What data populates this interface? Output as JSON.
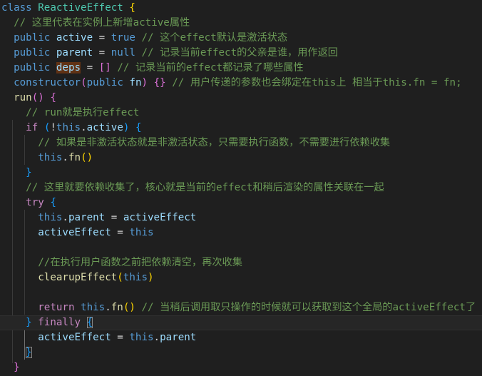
{
  "editor": {
    "language": "typescript",
    "highlighted_word": "deps",
    "lines": [
      {
        "tokens": [
          [
            "kw",
            "class"
          ],
          [
            "punc",
            " "
          ],
          [
            "cls",
            "ReactiveEffect"
          ],
          [
            "punc",
            " "
          ],
          [
            "b1",
            "{"
          ]
        ]
      },
      {
        "tokens": [
          [
            "punc",
            "  "
          ],
          [
            "cm",
            "// 这里代表在实例上新增active属性"
          ]
        ]
      },
      {
        "tokens": [
          [
            "punc",
            "  "
          ],
          [
            "kw",
            "public"
          ],
          [
            "punc",
            " "
          ],
          [
            "prop",
            "active"
          ],
          [
            "punc",
            " = "
          ],
          [
            "kw",
            "true"
          ],
          [
            "punc",
            " "
          ],
          [
            "cm",
            "// 这个effect默认是激活状态"
          ]
        ]
      },
      {
        "tokens": [
          [
            "punc",
            "  "
          ],
          [
            "kw",
            "public"
          ],
          [
            "punc",
            " "
          ],
          [
            "prop",
            "parent"
          ],
          [
            "punc",
            " = "
          ],
          [
            "kw",
            "null"
          ],
          [
            "punc",
            " "
          ],
          [
            "cm",
            "// 记录当前effect的父亲是谁，用作返回"
          ]
        ]
      },
      {
        "tokens": [
          [
            "punc",
            "  "
          ],
          [
            "kw",
            "public"
          ],
          [
            "punc",
            " "
          ],
          [
            "hl",
            "deps"
          ],
          [
            "punc",
            " = "
          ],
          [
            "b2",
            "[]"
          ],
          [
            "punc",
            " "
          ],
          [
            "cm",
            "// 记录当前的effect都记录了哪些属性"
          ]
        ]
      },
      {
        "tokens": [
          [
            "punc",
            "  "
          ],
          [
            "kw",
            "constructor"
          ],
          [
            "b2",
            "("
          ],
          [
            "kw",
            "public"
          ],
          [
            "punc",
            " "
          ],
          [
            "prop",
            "fn"
          ],
          [
            "b2",
            ")"
          ],
          [
            "punc",
            " "
          ],
          [
            "b2",
            "{}"
          ],
          [
            "punc",
            " "
          ],
          [
            "cm",
            "// 用户传递的参数也会绑定在this上 相当于this.fn = fn;"
          ]
        ]
      },
      {
        "tokens": [
          [
            "punc",
            "  "
          ],
          [
            "fn",
            "run"
          ],
          [
            "b2",
            "()"
          ],
          [
            "punc",
            " "
          ],
          [
            "b2",
            "{"
          ]
        ]
      },
      {
        "tokens": [
          [
            "punc",
            "    "
          ],
          [
            "cm",
            "// run就是执行effect"
          ]
        ]
      },
      {
        "tokens": [
          [
            "punc",
            "    "
          ],
          [
            "kw2",
            "if"
          ],
          [
            "punc",
            " "
          ],
          [
            "b3",
            "("
          ],
          [
            "punc",
            "!"
          ],
          [
            "kw",
            "this"
          ],
          [
            "punc",
            "."
          ],
          [
            "prop",
            "active"
          ],
          [
            "b3",
            ")"
          ],
          [
            "punc",
            " "
          ],
          [
            "b3",
            "{"
          ]
        ]
      },
      {
        "tokens": [
          [
            "punc",
            "      "
          ],
          [
            "cm",
            "// 如果是非激活状态就是非激活状态，只需要执行函数，不需要进行依赖收集"
          ]
        ]
      },
      {
        "tokens": [
          [
            "punc",
            "      "
          ],
          [
            "kw",
            "this"
          ],
          [
            "punc",
            "."
          ],
          [
            "fn",
            "fn"
          ],
          [
            "b1",
            "()"
          ]
        ]
      },
      {
        "tokens": [
          [
            "punc",
            "    "
          ],
          [
            "b3",
            "}"
          ]
        ]
      },
      {
        "tokens": [
          [
            "punc",
            "    "
          ],
          [
            "cm",
            "// 这里就要依赖收集了，核心就是当前的effect和稍后渲染的属性关联在一起"
          ]
        ]
      },
      {
        "tokens": [
          [
            "punc",
            "    "
          ],
          [
            "kw2",
            "try"
          ],
          [
            "punc",
            " "
          ],
          [
            "b3",
            "{"
          ]
        ]
      },
      {
        "tokens": [
          [
            "punc",
            "      "
          ],
          [
            "kw",
            "this"
          ],
          [
            "punc",
            "."
          ],
          [
            "prop",
            "parent"
          ],
          [
            "punc",
            " = "
          ],
          [
            "prop",
            "activeEffect"
          ]
        ]
      },
      {
        "tokens": [
          [
            "punc",
            "      "
          ],
          [
            "prop",
            "activeEffect"
          ],
          [
            "punc",
            " = "
          ],
          [
            "kw",
            "this"
          ]
        ]
      },
      {
        "tokens": []
      },
      {
        "tokens": [
          [
            "punc",
            "      "
          ],
          [
            "cm",
            "//在执行用户函数之前把依赖清空，再次收集"
          ]
        ]
      },
      {
        "tokens": [
          [
            "punc",
            "      "
          ],
          [
            "fn",
            "clearupEffect"
          ],
          [
            "b1",
            "("
          ],
          [
            "kw",
            "this"
          ],
          [
            "b1",
            ")"
          ]
        ]
      },
      {
        "tokens": []
      },
      {
        "tokens": [
          [
            "punc",
            "      "
          ],
          [
            "kw2",
            "return"
          ],
          [
            "punc",
            " "
          ],
          [
            "kw",
            "this"
          ],
          [
            "punc",
            "."
          ],
          [
            "fn",
            "fn"
          ],
          [
            "b1",
            "()"
          ],
          [
            "punc",
            " "
          ],
          [
            "cm",
            "// 当稍后调用取只操作的时候就可以获取到这个全局的activeEffect了"
          ]
        ]
      },
      {
        "tokens": [
          [
            "punc",
            "    "
          ],
          [
            "b3",
            "}"
          ],
          [
            "punc",
            " "
          ],
          [
            "kw2",
            "finally"
          ],
          [
            "punc",
            " "
          ],
          [
            "bm",
            "{"
          ]
        ],
        "current": true
      },
      {
        "tokens": [
          [
            "punc",
            "      "
          ],
          [
            "prop",
            "activeEffect"
          ],
          [
            "punc",
            " = "
          ],
          [
            "kw",
            "this"
          ],
          [
            "punc",
            "."
          ],
          [
            "prop",
            "parent"
          ]
        ]
      },
      {
        "tokens": [
          [
            "punc",
            "    "
          ],
          [
            "bm",
            "}"
          ]
        ]
      },
      {
        "tokens": [
          [
            "punc",
            "  "
          ],
          [
            "b2",
            "}"
          ]
        ]
      }
    ]
  }
}
